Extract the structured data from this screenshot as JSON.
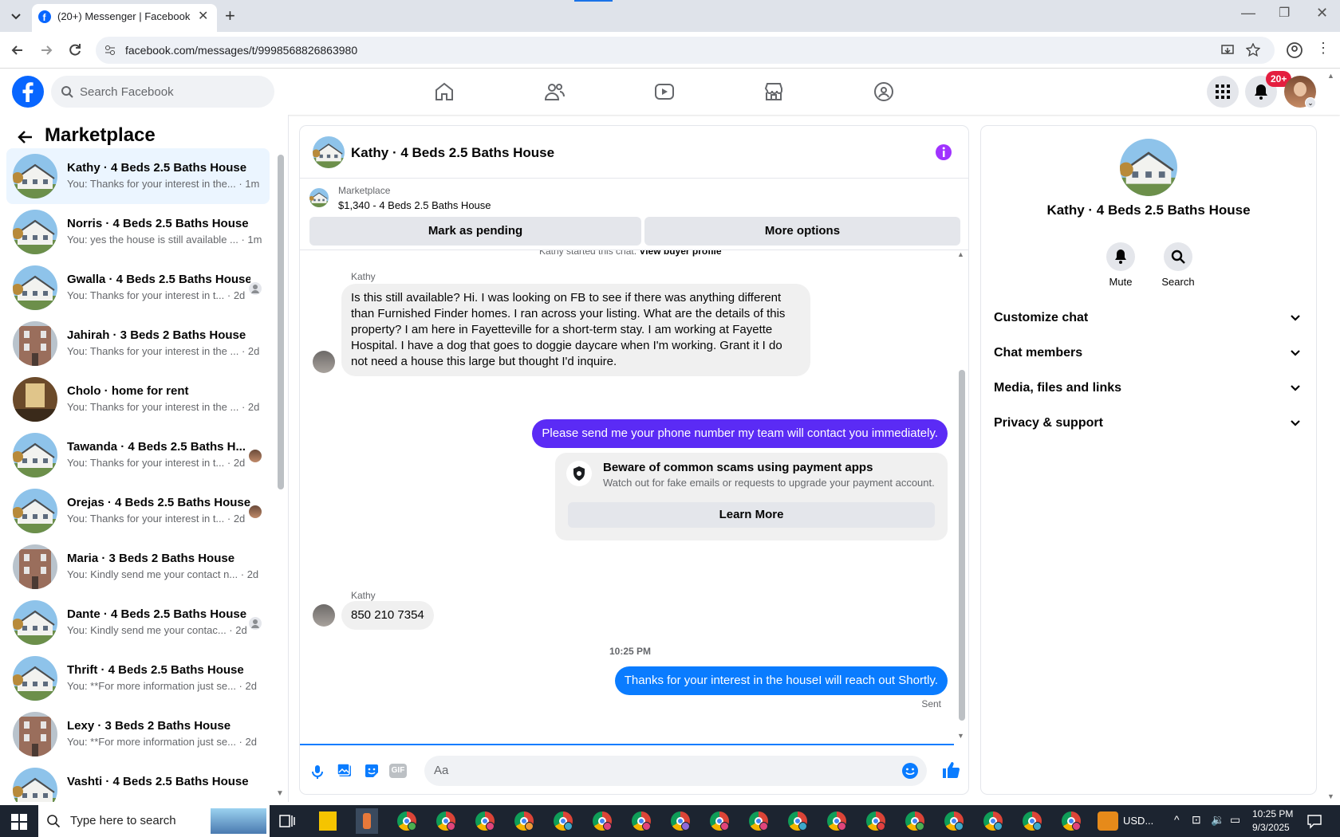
{
  "browser": {
    "tab_title": "(20+) Messenger | Facebook",
    "url": "facebook.com/messages/t/9998568826863980"
  },
  "fb_header": {
    "search_placeholder": "Search Facebook",
    "notification_badge": "20+"
  },
  "sidebar": {
    "title": "Marketplace",
    "conversations": [
      {
        "name": "Kathy · 4 Beds 2.5 Baths House",
        "snippet": "You: Thanks for your interest in the... · 1m",
        "active": true
      },
      {
        "name": "Norris · 4 Beds 2.5 Baths House",
        "snippet": "You: yes the house is still available ... · 1m"
      },
      {
        "name": "Gwalla · 4 Beds 2.5 Baths House",
        "snippet": "You: Thanks for your interest in t... · 2d"
      },
      {
        "name": "Jahirah · 3 Beds 2 Baths House",
        "snippet": "You: Thanks for your interest in the ... · 2d"
      },
      {
        "name": "Cholo · home for rent",
        "snippet": "You: Thanks for your interest in the ... · 2d"
      },
      {
        "name": "Tawanda · 4 Beds 2.5 Baths H...",
        "snippet": "You: Thanks for your interest in t... · 2d"
      },
      {
        "name": "Orejas · 4 Beds 2.5 Baths House",
        "snippet": "You: Thanks for your interest in t... · 2d"
      },
      {
        "name": "Maria · 3 Beds 2 Baths House",
        "snippet": "You: Kindly send me your contact n... · 2d"
      },
      {
        "name": "Dante · 4 Beds 2.5 Baths House",
        "snippet": "You: Kindly send me your contac... · 2d"
      },
      {
        "name": "Thrift · 4 Beds 2.5 Baths House",
        "snippet": "You: **For more information just se... · 2d"
      },
      {
        "name": "Lexy · 3 Beds 2 Baths House",
        "snippet": "You: **For more information just se... · 2d"
      },
      {
        "name": "Vashti · 4 Beds 2.5 Baths House",
        "snippet": ""
      }
    ]
  },
  "chat": {
    "title": "Kathy · 4 Beds 2.5 Baths House",
    "listing_source": "Marketplace",
    "listing_desc": "$1,340 - 4 Beds 2.5 Baths House",
    "mark_pending": "Mark as pending",
    "more_options": "More options",
    "started_text": "Kathy started this chat.",
    "view_profile": "View buyer profile",
    "sender1": "Kathy",
    "msg1": "Is this still available?  Hi. I was looking on FB to see if there was anything different than Furnished Finder homes. I ran across your listing. What are the details of this property? I am here in Fayetteville for a short-term stay. I am working at Fayette Hospital.  I have a dog that goes to doggie daycare when I'm working.  Grant it I do not need a house this large but thought I'd inquire.",
    "msg2": "Please send me your phone number my team will contact you immediately.",
    "scam_title": "Beware of common scams using payment apps",
    "scam_desc": "Watch out for fake emails or requests to upgrade your payment account.",
    "learn_more": "Learn More",
    "sender2": "Kathy",
    "msg3": "850 210 7354",
    "timestamp": "10:25 PM",
    "msg4": "Thanks for your interest in the houseI will reach out Shortly.",
    "sent_label": "Sent",
    "composer_placeholder": "Aa"
  },
  "info_panel": {
    "title": "Kathy · 4 Beds 2.5 Baths House",
    "mute": "Mute",
    "search": "Search",
    "rows": [
      "Customize chat",
      "Chat members",
      "Media, files and links",
      "Privacy & support"
    ]
  },
  "taskbar": {
    "search_placeholder": "Type here to search",
    "weather": "USD...",
    "time": "10:25 PM",
    "date": "9/3/2025"
  },
  "colors": {
    "fb_blue": "#0866ff",
    "outgoing_purple": "#5b2bf5",
    "outgoing_blue": "#0a7cff",
    "info_purple": "#a033ff"
  }
}
